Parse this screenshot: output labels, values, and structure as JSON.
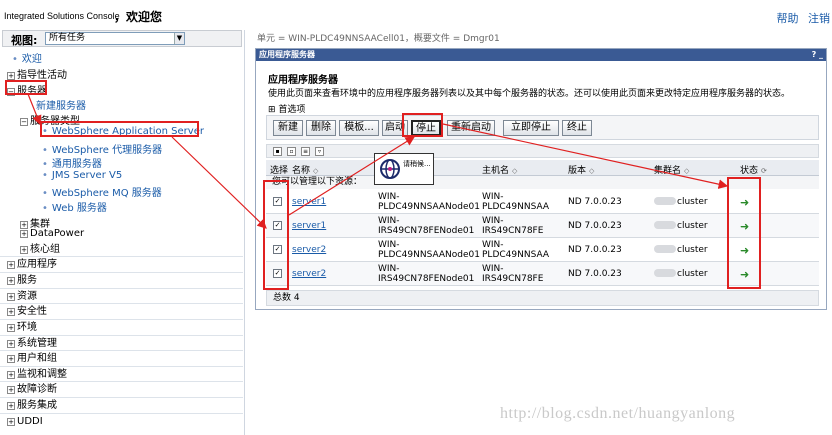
{
  "banner": {
    "brand": "Integrated Solutions Console",
    "welcome": "，欢迎您",
    "help": "帮助",
    "logout": "注销"
  },
  "nav": {
    "view_label": "视图:",
    "view_value": "所有任务",
    "welcome": "欢迎",
    "guided": "指导性活动",
    "servers": "服务器",
    "new_server": "新建服务器",
    "server_types": "服务器类型",
    "types": [
      "WebSphere Application Server",
      "WebSphere 代理服务器",
      "通用服务器",
      "JMS Server V5",
      "WebSphere MQ 服务器",
      "Web 服务器"
    ],
    "clusters": "集群",
    "datapower": "DataPower",
    "core_groups": "核心组",
    "sections": [
      "应用程序",
      "服务",
      "资源",
      "安全性",
      "环境",
      "系统管理",
      "用户和组",
      "监视和调整",
      "故障诊断",
      "服务集成",
      "UDDI"
    ]
  },
  "main": {
    "scope": "单元 = WIN-PLDC49NNSAACell01，概要文件 = Dmgr01",
    "portlet_title": "应用程序服务器",
    "portlet_controls": "? _",
    "section_title": "应用程序服务器",
    "description": "使用此页面来查看环境中的应用程序服务器列表以及其中每个服务器的状态。还可以使用此页面来更改特定应用程序服务器的状态。",
    "preferences": "首选项",
    "buttons": {
      "new": "新建",
      "delete": "删除",
      "template": "模板...",
      "start": "启动",
      "stop": "停止",
      "restart": "重新启动",
      "immediate_stop": "立即停止",
      "terminate": "终止"
    },
    "columns": [
      "选择",
      "名称",
      "节点",
      "主机名",
      "版本",
      "集群名",
      "状态"
    ],
    "manage_label": "您可以管理以下资源：",
    "rows": [
      {
        "name": "server1",
        "node": [
          "WIN-",
          "PLDC49NNSAANode01"
        ],
        "host": [
          "WIN-",
          "PLDC49NNSAA"
        ],
        "version": "ND 7.0.0.23",
        "cluster": "cluster",
        "status": "➜"
      },
      {
        "name": "server1",
        "node": [
          "WIN-",
          "IRS49CN78FENode01"
        ],
        "host": [
          "WIN-",
          "IRS49CN78FE"
        ],
        "version": "ND 7.0.0.23",
        "cluster": "cluster",
        "status": "➜"
      },
      {
        "name": "server2",
        "node": [
          "WIN-",
          "PLDC49NNSAANode01"
        ],
        "host": [
          "WIN-",
          "PLDC49NNSAA"
        ],
        "version": "ND 7.0.0.23",
        "cluster": "cluster",
        "status": "➜"
      },
      {
        "name": "server2",
        "node": [
          "WIN-",
          "IRS49CN78FENode01"
        ],
        "host": [
          "WIN-",
          "IRS49CN78FE"
        ],
        "version": "ND 7.0.0.23",
        "cluster": "cluster",
        "status": "➜"
      }
    ],
    "total": "总数 4",
    "popup_text": "请稍候..."
  },
  "watermark": "http://blog.csdn.net/huangyanlong",
  "colors": {
    "annotation": "#e02020",
    "link": "#1a5ba8",
    "title_bar": "#3a5a94",
    "running": "#2a8a2a"
  }
}
